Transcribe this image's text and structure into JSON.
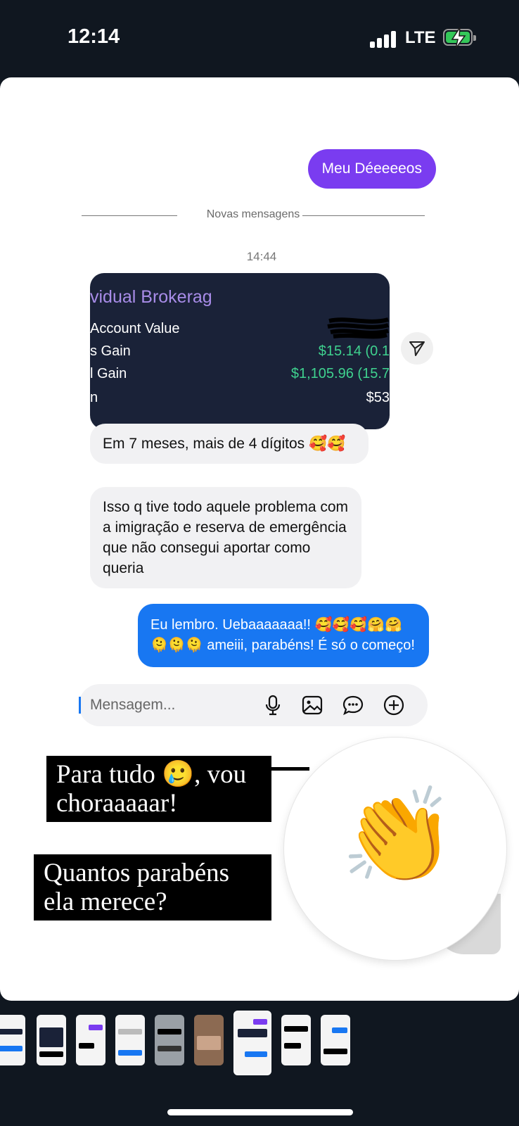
{
  "status_bar": {
    "time": "12:14",
    "network": "LTE",
    "battery_charging": true,
    "battery_color": "#34c759"
  },
  "chat": {
    "sent_top": "Meu Déeeeeos",
    "divider_label": "Novas mensagens",
    "timestamp": "14:44",
    "shared_card": {
      "heading": "vidual Brokerag",
      "rows": [
        {
          "label": "Account Value",
          "value": ""
        },
        {
          "label": "s Gain",
          "value": "$15.14 (0.1"
        },
        {
          "label": "l Gain",
          "value": "$1,105.96 (15.7"
        },
        {
          "label": "n",
          "value": "$53"
        }
      ],
      "gain_color": "#3fd28f",
      "bg_color": "#1a2238"
    },
    "received": [
      "Em 7 meses, mais de 4 dígitos 🥰🥰",
      "Isso q tive todo aquele problema com a imigração e reserva de emergência que não consegui aportar como queria"
    ],
    "sent_reply": "Eu lembro. Uebaaaaaaa!! 🥰🥰🥰🤗🤗🫠🫠🫠 ameiii, parabéns! É só o começo!",
    "composer_placeholder": "Mensagem...",
    "icons": [
      "mic-icon",
      "gallery-icon",
      "sticker-icon",
      "plus-circle-icon"
    ],
    "colors": {
      "purple": "#7a3cf0",
      "blue": "#1877f2"
    }
  },
  "overlays": {
    "caption_1": "Para tudo 🥲, vou choraaaaar!",
    "caption_2": "Quantos parabéns ela merece?",
    "emoji_slider": "👏"
  },
  "thumbnails": {
    "count": 9,
    "active_index": 6
  }
}
